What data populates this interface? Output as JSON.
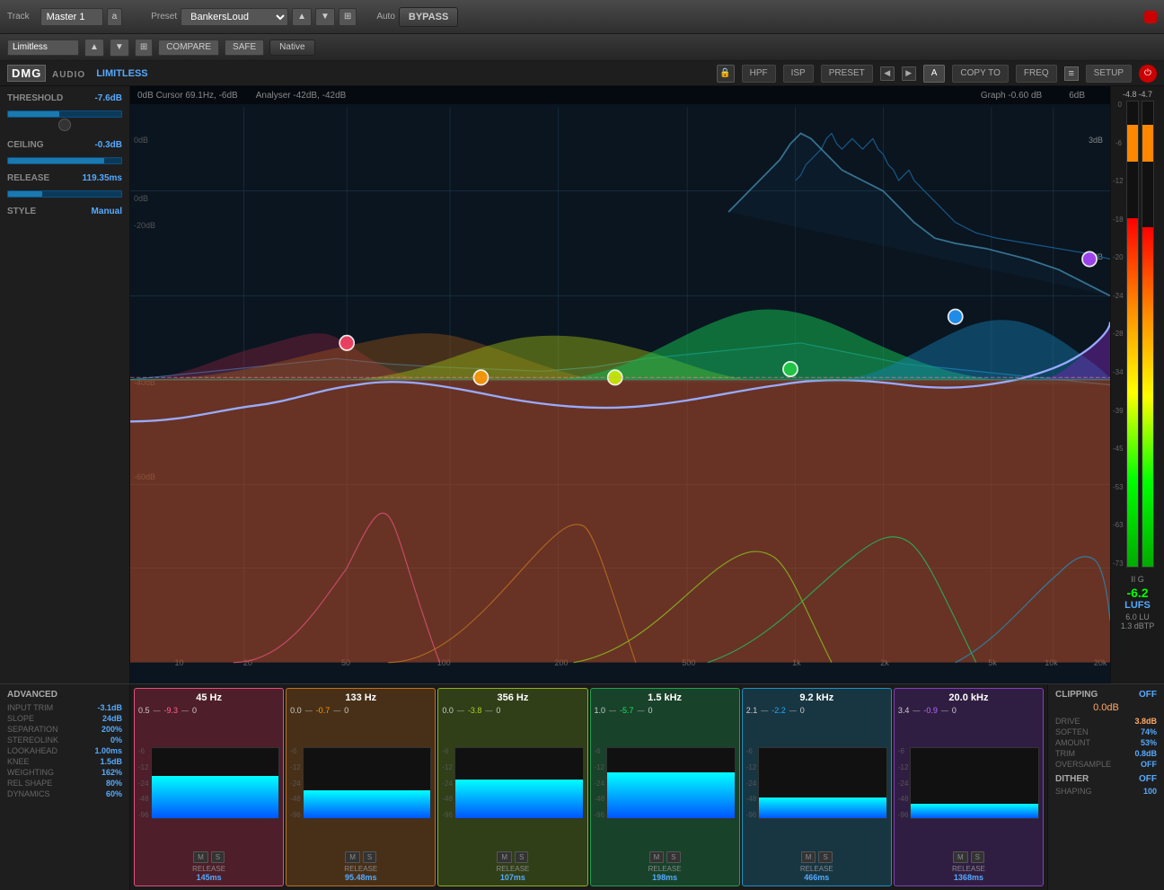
{
  "topbar": {
    "track_label": "Track",
    "master_value": "Master 1",
    "a_btn": "a",
    "preset_label": "Preset",
    "preset_value": "BankersLoud",
    "auto_label": "Auto",
    "bypass_btn": "BYPASS",
    "compare_btn": "COMPARE",
    "safe_btn": "SAFE",
    "native_btn": "Native",
    "limitless_input": "Limitless"
  },
  "plugin_header": {
    "dmg": "DMG",
    "audio": "AUDIO",
    "limitless": "LIMITLESS",
    "hpf": "HPF",
    "isp": "ISP",
    "preset": "PRESET",
    "a_btn": "A",
    "copy_to": "COPY TO",
    "freq": "FREQ",
    "setup": "SETUP"
  },
  "eq_info": {
    "cursor": "0dB  Cursor 69.1Hz, -6dB",
    "analyser": "Analyser -42dB, -42dB",
    "graph": "Graph -0.60 dB",
    "graph_val": "6dB"
  },
  "left_panel": {
    "threshold_label": "THRESHOLD",
    "threshold_value": "-7.6dB",
    "ceiling_label": "CEILING",
    "ceiling_value": "-0.3dB",
    "release_label": "RELEASE",
    "release_value": "119.35ms",
    "style_label": "STYLE",
    "style_value": "Manual"
  },
  "right_meters": {
    "label_left": "-4.8",
    "label_right": "-4.7",
    "lufs_prefix": "II G",
    "lufs_value": "-6.2",
    "lufs_unit": "LUFS",
    "lu_value": "6.0 LU",
    "dbtp_value": "1.3 dBTP"
  },
  "advanced": {
    "title": "ADVANCED",
    "input_trim_label": "INPUT TRIM",
    "input_trim_value": "-3.1dB",
    "slope_label": "SLOPE",
    "slope_value": "24dB",
    "separation_label": "SEPARATION",
    "separation_value": "200%",
    "stereolink_label": "STEREOLINK",
    "stereolink_value": "0%",
    "lookahead_label": "LOOKAHEAD",
    "lookahead_value": "1.00ms",
    "knee_label": "KNEE",
    "knee_value": "1.5dB",
    "weighting_label": "WEIGHTING",
    "weighting_value": "162%",
    "rel_shape_label": "REL SHAPE",
    "rel_shape_value": "80%",
    "dynamics_label": "DYNAMICS",
    "dynamics_value": "60%"
  },
  "bands": [
    {
      "freq": "45 Hz",
      "color": "pink",
      "gain1": "0.5",
      "gain2": "-9.3",
      "gain3": "0",
      "release": "145ms",
      "meter_height": 60
    },
    {
      "freq": "133 Hz",
      "color": "orange",
      "gain1": "0.0",
      "gain2": "-0.7",
      "gain3": "0",
      "release": "95.48ms",
      "meter_height": 40
    },
    {
      "freq": "356 Hz",
      "color": "yellow-green",
      "gain1": "0.0",
      "gain2": "-3.8",
      "gain3": "0",
      "release": "107ms",
      "meter_height": 55
    },
    {
      "freq": "1.5 kHz",
      "color": "green",
      "gain1": "1.0",
      "gain2": "-5.7",
      "gain3": "0",
      "release": "198ms",
      "meter_height": 65
    },
    {
      "freq": "9.2 kHz",
      "color": "teal",
      "gain1": "2.1",
      "gain2": "-2.2",
      "gain3": "0",
      "release": "466ms",
      "meter_height": 30
    },
    {
      "freq": "20.0 kHz",
      "color": "purple",
      "gain1": "3.4",
      "gain2": "-0.9",
      "gain3": "0",
      "release": "1368ms",
      "meter_height": 20
    }
  ],
  "clipping": {
    "title": "CLIPPING",
    "off_label": "OFF",
    "db_value": "0.0dB",
    "drive_label": "DRIVE",
    "drive_value": "3.8dB",
    "soften_label": "SOFTEN",
    "soften_value": "74%",
    "amount_label": "AMOUNT",
    "amount_value": "53%",
    "trim_label": "TRIM",
    "trim_value": "0.8dB",
    "oversample_label": "OVERSAMPLE",
    "oversample_value": "OFF",
    "dither_label": "DITHER",
    "dither_off": "OFF",
    "shaping_label": "SHAPING",
    "shaping_value": "100"
  },
  "freq_markers": [
    "10",
    "20",
    "50",
    "100",
    "200",
    "500",
    "1k",
    "2k",
    "5k",
    "10k",
    "20k"
  ],
  "db_markers_left": [
    "-20dB",
    "-40dB",
    "-60dB"
  ],
  "db_markers_right": [
    "3dB",
    "0dB",
    "-3dB"
  ]
}
